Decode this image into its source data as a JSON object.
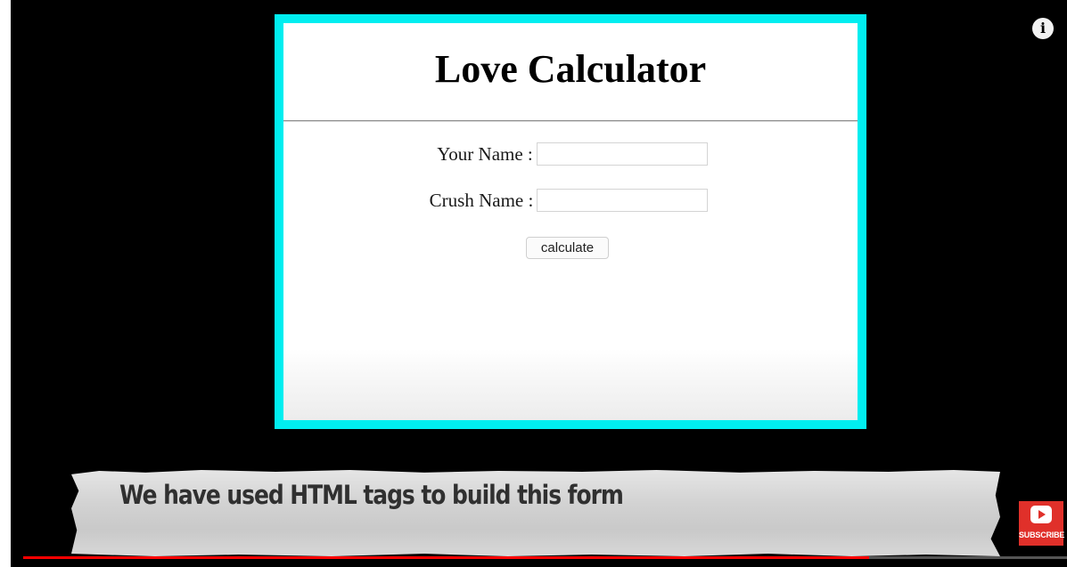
{
  "video": {
    "calculator": {
      "title": "Love Calculator",
      "your_name_label": "Your Name :",
      "your_name_value": "",
      "crush_name_label": "Crush Name :",
      "crush_name_value": "",
      "button_label": "calculate"
    },
    "caption": "We have used HTML tags to build this form"
  },
  "player": {
    "info_icon": "info-icon",
    "info_glyph": "i",
    "subscribe_label": "SUBSCRIBE",
    "progress_fraction": 0.81
  },
  "colors": {
    "frame_border": "#00eef0",
    "progress": "#ff0000",
    "subscribe_bg": "#e0302a"
  }
}
